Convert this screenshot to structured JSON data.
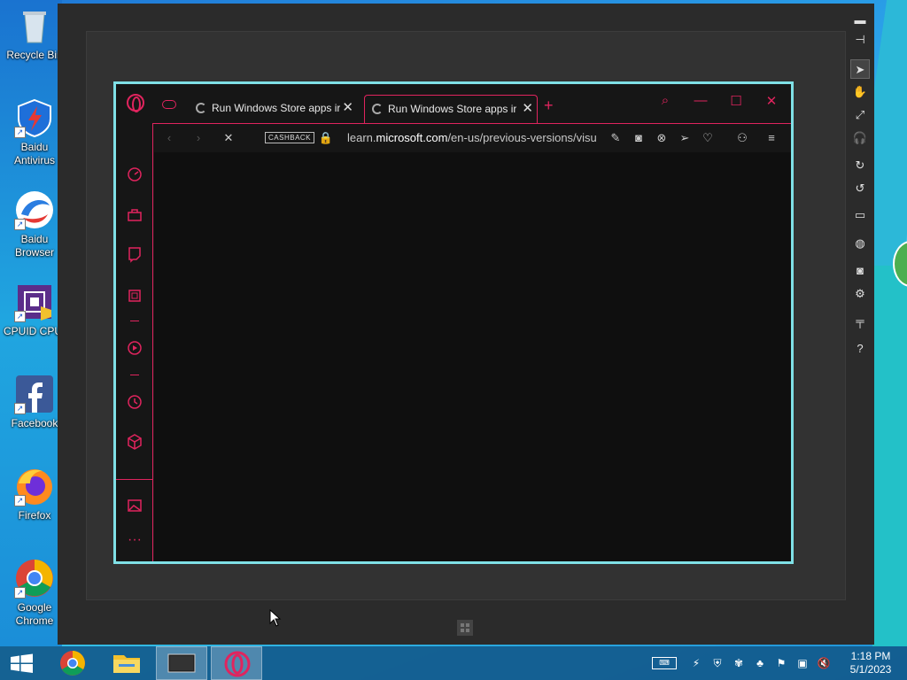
{
  "desktop": {
    "icons": [
      {
        "label": "Recycle Bin",
        "icon": "recycle-bin-icon"
      },
      {
        "label": "Baidu Antivirus",
        "icon": "baidu-antivirus-icon"
      },
      {
        "label": "Baidu Browser",
        "icon": "baidu-browser-icon"
      },
      {
        "label": "CPUID CPU-",
        "icon": "cpuid-icon"
      },
      {
        "label": "Facebook",
        "icon": "facebook-icon"
      },
      {
        "label": "Firefox",
        "icon": "firefox-icon"
      },
      {
        "label": "Google Chrome",
        "icon": "chrome-icon"
      }
    ]
  },
  "emulator": {
    "sidebar_icons": [
      "minimize-icon",
      "pin-icon",
      "pointer-icon",
      "hand-icon",
      "expand-icon",
      "volume-icon",
      "rotate-cw-icon",
      "rotate-ccw-icon",
      "monitor-icon",
      "globe-icon",
      "camera-icon",
      "gear-icon",
      "controller-icon",
      "help-icon"
    ],
    "help_label": "?"
  },
  "browser": {
    "tabs": [
      {
        "title": "Run Windows Store apps ir",
        "active": false
      },
      {
        "title": "Run Windows Store apps ir",
        "active": true
      }
    ],
    "new_tab_label": "+",
    "toolbar": {
      "cashback_label": "CASHBACK",
      "url_prefix": "learn.",
      "url_domain": "microsoft.com",
      "url_path": "/en-us/previous-versions/visu"
    },
    "accent_color": "#e0245e",
    "frame_color": "#7fe0e6"
  },
  "taskbar": {
    "pinned": [
      "start-icon",
      "chrome-icon",
      "file-explorer-icon",
      "emulator-icon",
      "opera-icon"
    ],
    "clock_time": "1:18 PM",
    "clock_date": "5/1/2023"
  }
}
